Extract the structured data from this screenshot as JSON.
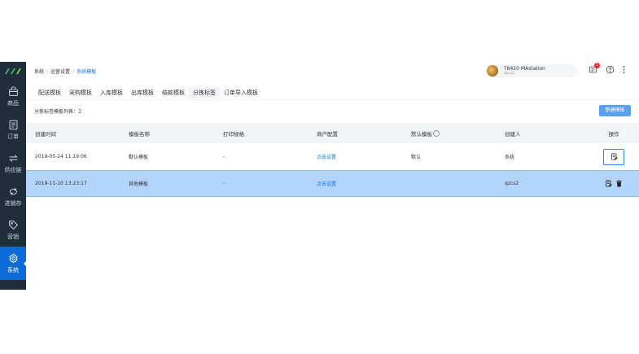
{
  "sidebar": {
    "items": [
      {
        "label": "商品",
        "icon": "bag-icon"
      },
      {
        "label": "订单",
        "icon": "order-icon"
      },
      {
        "label": "供应链",
        "icon": "exchange-icon"
      },
      {
        "label": "进销存",
        "icon": "inventory-icon"
      },
      {
        "label": "营销",
        "icon": "tag-icon"
      },
      {
        "label": "系统",
        "icon": "gear-icon",
        "active": true
      }
    ]
  },
  "header": {
    "breadcrumb": [
      "系统",
      "运营设置",
      "系统模板"
    ],
    "user": {
      "name": "T8420 MAstation",
      "sub": "qzcs2"
    },
    "notification_count": "1"
  },
  "tabs": [
    {
      "label": "配送模板"
    },
    {
      "label": "采购模板"
    },
    {
      "label": "入库模板"
    },
    {
      "label": "出库模板"
    },
    {
      "label": "结款模板"
    },
    {
      "label": "分拣标签",
      "active": true
    },
    {
      "label": "订单导入模板"
    }
  ],
  "list": {
    "count_label": "分拣标签模板列表：",
    "count": "2",
    "new_button": "新建模板"
  },
  "table": {
    "headers": [
      "创建时间",
      "模板名称",
      "打印规格",
      "商户配置",
      "默认模板",
      "创建人",
      "操作"
    ],
    "rows": [
      {
        "created": "2019-05-24 11:19:06",
        "name": "默认模板",
        "spec": "-",
        "config": "点击设置",
        "default": "默认",
        "creator": "系统"
      },
      {
        "created": "2019-11-10 13:23:17",
        "name": "其他模板",
        "spec": "-",
        "config": "点击设置",
        "default": "",
        "creator": "qzcs2"
      }
    ]
  },
  "colors": {
    "accent": "#0b74e5",
    "sidebar": "#1f2d3d",
    "selected_row": "#b3d4fc"
  }
}
